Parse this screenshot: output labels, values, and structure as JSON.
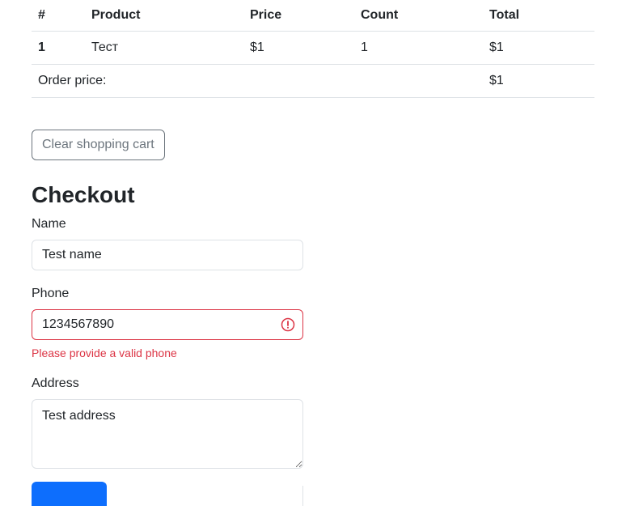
{
  "table": {
    "headers": [
      "#",
      "Product",
      "Price",
      "Count",
      "Total"
    ],
    "rows": [
      {
        "index": "1",
        "product": "Тест",
        "price": "$1",
        "count": "1",
        "total": "$1"
      }
    ],
    "summary": {
      "label": "Order price:",
      "total": "$1"
    }
  },
  "actions": {
    "clear_label": "Clear shopping cart"
  },
  "checkout": {
    "title": "Checkout",
    "name": {
      "label": "Name",
      "value": "Test name"
    },
    "phone": {
      "label": "Phone",
      "value": "1234567890",
      "error": "Please provide a valid phone"
    },
    "address": {
      "label": "Address",
      "value": "Test address"
    }
  },
  "colors": {
    "primary": "#0d6efd",
    "danger": "#dc3545",
    "secondary": "#6c757d",
    "border": "#dee2e6"
  },
  "icons": {
    "phone_invalid": "exclamation-circle-icon"
  }
}
